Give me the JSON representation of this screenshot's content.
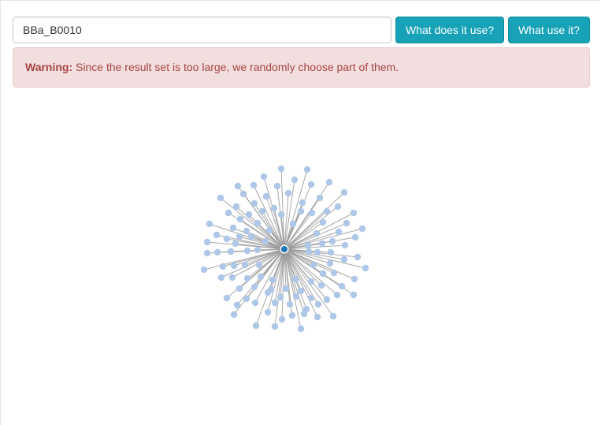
{
  "search": {
    "value": "BBa_B0010"
  },
  "buttons": {
    "what_does_it_use": "What does it use?",
    "what_use_it": "What use it?"
  },
  "alert": {
    "prefix": "Warning:",
    "message": " Since the result set is too large, we randomly choose part of them."
  },
  "graph": {
    "center_node_color": "#1f77b4",
    "leaf_node_color": "#aec7e8",
    "edge_color": "#999999",
    "leaf_node_count": 110
  }
}
